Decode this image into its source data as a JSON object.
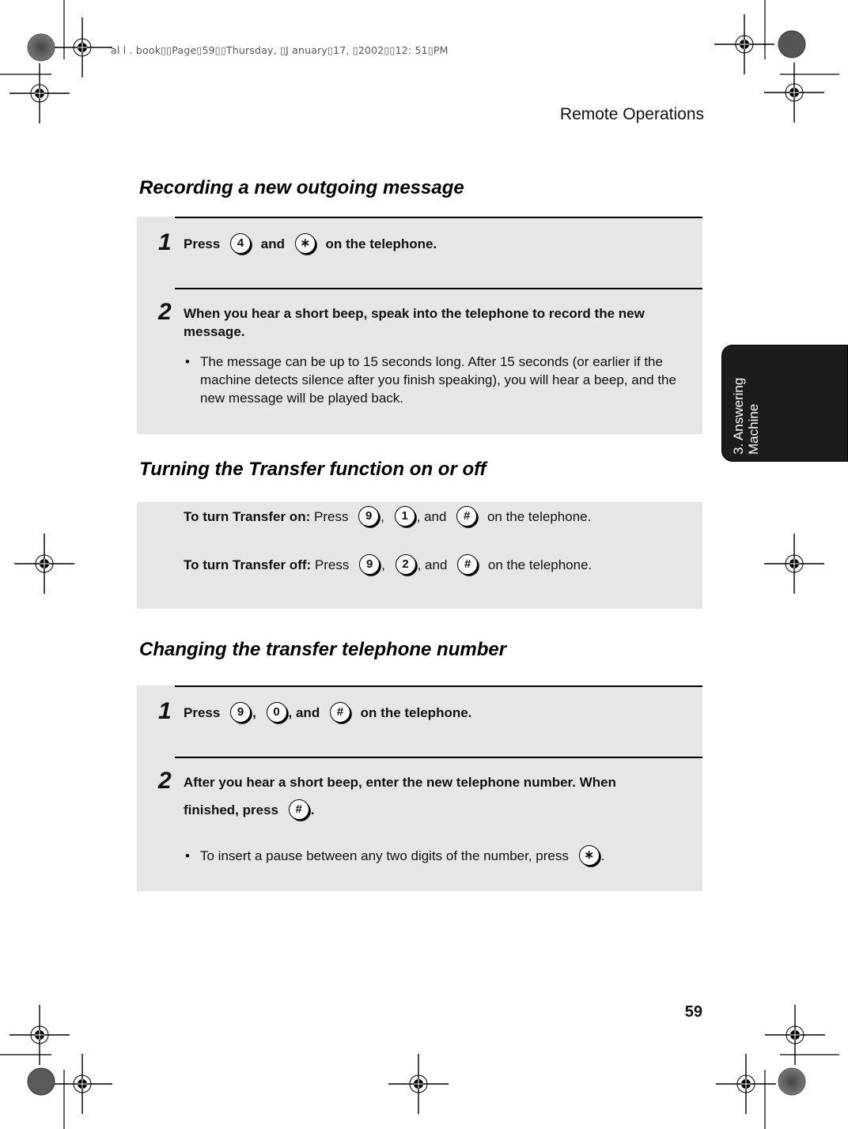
{
  "print_meta": "al l . book▯▯Page▯59▯▯Thursday, ▯J anuary▯17, ▯2002▯▯12: 51▯PM",
  "running_head": "Remote Operations",
  "page_number": "59",
  "chapter_tab": {
    "line1": "3. Answering",
    "line2": "Machine"
  },
  "sections": [
    {
      "title": "Recording a new outgoing message",
      "steps": [
        {
          "number": "1",
          "parts": [
            "Press",
            "4",
            "and",
            "∗",
            "on the telephone."
          ]
        },
        {
          "number": "2",
          "text": "When you hear a short beep, speak into the telephone to record the new message.",
          "bullet": "The message can be up to 15 seconds long. After 15 seconds (or earlier if the machine detects silence after you finish speaking), you will hear a beep, and the new message will be played back."
        }
      ]
    },
    {
      "title": "Turning the Transfer function on or off",
      "lines": [
        {
          "label": "To turn Transfer on:",
          "press": "Press",
          "keys": [
            "9",
            "1",
            "#"
          ],
          "sep1": ",",
          "sep2": ", and",
          "tail": "on the telephone."
        },
        {
          "label": "To turn Transfer off:",
          "press": "Press",
          "keys": [
            "9",
            "2",
            "#"
          ],
          "sep1": ",",
          "sep2": ", and",
          "tail": "on the telephone."
        }
      ]
    },
    {
      "title": "Changing the transfer telephone number",
      "steps": [
        {
          "number": "1",
          "press": "Press",
          "keys": [
            "9",
            "0",
            "#"
          ],
          "sep1": ",",
          "sep2": ", and",
          "tail": "on the telephone."
        },
        {
          "number": "2",
          "text": "After you hear a short beep, enter the new telephone number. When",
          "text2": "finished, press",
          "key": "#",
          "end": ".",
          "bullet": "To insert a pause between any two digits of the number, press",
          "bullet_key": "∗",
          "bullet_end": "."
        }
      ]
    }
  ],
  "bullet_glyph": "•"
}
